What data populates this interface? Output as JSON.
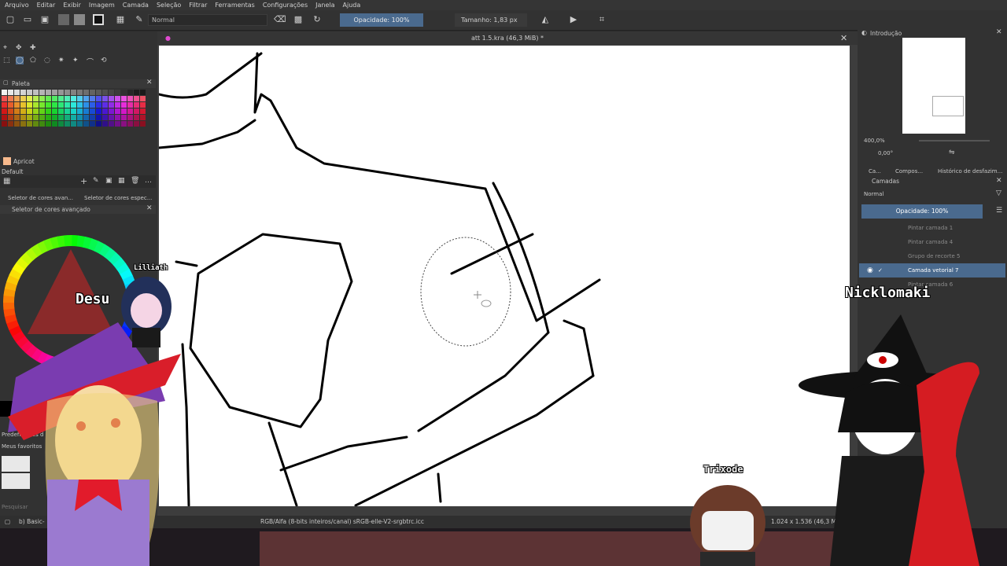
{
  "menubar": {
    "items": [
      "Arquivo",
      "Editar",
      "Exibir",
      "Imagem",
      "Camada",
      "Seleção",
      "Filtrar",
      "Ferramentas",
      "Configurações",
      "Janela",
      "Ajuda"
    ]
  },
  "toolbar": {
    "blend_mode": "Normal",
    "opacity_label": "Opacidade: 100%",
    "size_label": "Tamanho: 1,83 px"
  },
  "document": {
    "title": "att 1.5.kra (46,3 MiB) *"
  },
  "left_dock": {
    "palette_title": "Paleta",
    "palette_name": "Apricot",
    "palette_set": "Default",
    "tab_advanced": "Seletor de cores avan...",
    "tab_specific": "Seletor de cores espec...",
    "advanced_title": "Seletor de cores avançado",
    "brush_presets_title": "Predefinições d",
    "favorites": "Meus favoritos",
    "search_placeholder": "Pesquisar",
    "current_brush": "b) Basic-"
  },
  "status": {
    "colorspace": "RGB/Alfa (8-bits inteiros/canal)  sRGB-elle-V2-srgbtrc.icc",
    "dimensions": "1.024 x 1.536 (46,3 MiB)"
  },
  "right_dock": {
    "overview_title": "Introdução",
    "zoom": "400,0%",
    "rotation": "0,00°",
    "tabs": [
      "Ca...",
      "Compos...",
      "Histórico de desfazim..."
    ],
    "layers_title": "Camadas",
    "layer_blend": "Normal",
    "layer_opacity": "Opacidade:  100%",
    "layers": [
      {
        "name": "Pintar camada 1",
        "selected": false
      },
      {
        "name": "Pintar camada 4",
        "selected": false
      },
      {
        "name": "Grupo de recorte 5",
        "selected": false
      },
      {
        "name": "Camada vetorial 7",
        "selected": true
      },
      {
        "name": "Pintar camada 6",
        "selected": false
      }
    ]
  },
  "overlay": {
    "tag_lilliath": "Lilliath",
    "tag_desu": "Desu",
    "tag_nicklomaki": "Nicklomaki",
    "tag_trixode": "Trixode"
  },
  "colors": {
    "accent": "#4a6a8e",
    "canvas": "#ffffff",
    "panel": "#323232"
  }
}
